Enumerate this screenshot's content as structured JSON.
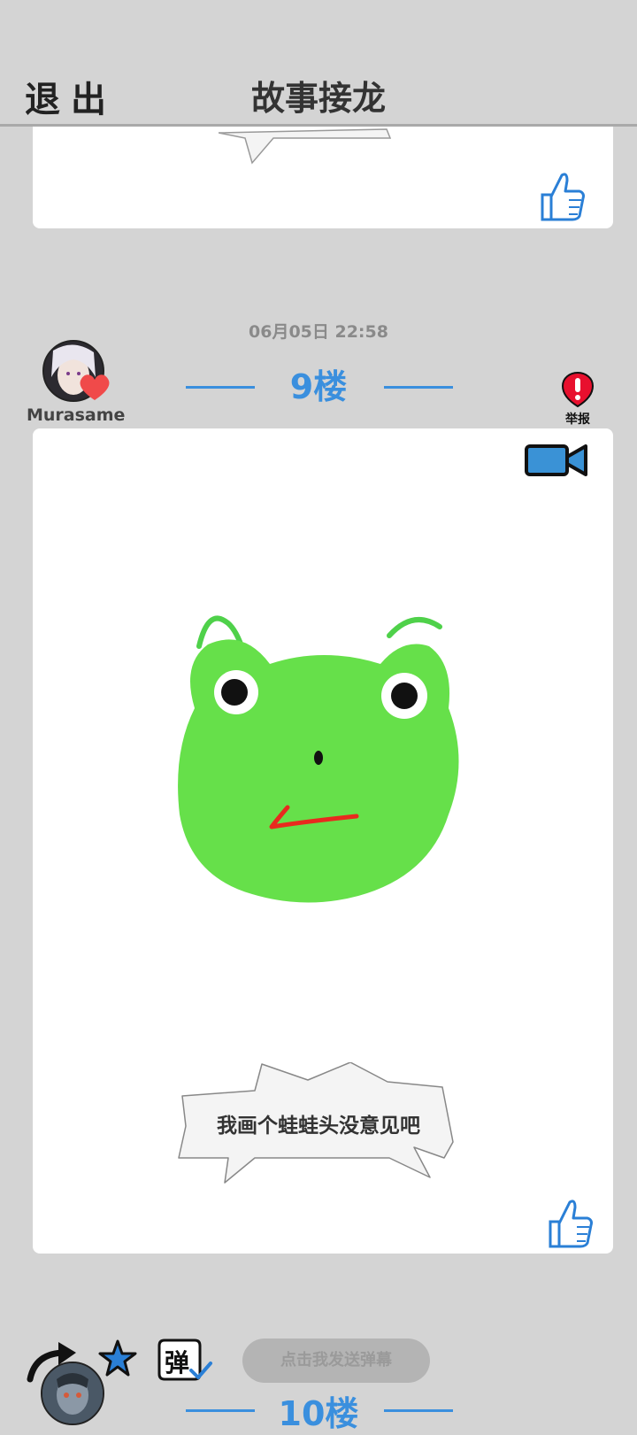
{
  "header": {
    "exit_label": "退出",
    "title": "故事接龙"
  },
  "post": {
    "timestamp": "06月05日  22:58",
    "username": "Murasame",
    "floor_label": "9楼",
    "report_label": "举报",
    "caption": "我画个蛙蛙头没意见吧",
    "icons": {
      "video": "video-camera-icon",
      "like": "thumbs-up-icon",
      "report": "exclamation-icon",
      "heart": "heart-icon"
    }
  },
  "next_post": {
    "floor_label": "10楼"
  },
  "bottom_bar": {
    "danmaku_placeholder": "点击我发送弹幕",
    "danmaku_toggle_label": "弹"
  },
  "colors": {
    "background": "#d4d4d4",
    "accent_blue": "#3a8fde",
    "frog_green": "#66e04a",
    "heart_red": "#f04a4a",
    "report_red": "#e8102e"
  }
}
